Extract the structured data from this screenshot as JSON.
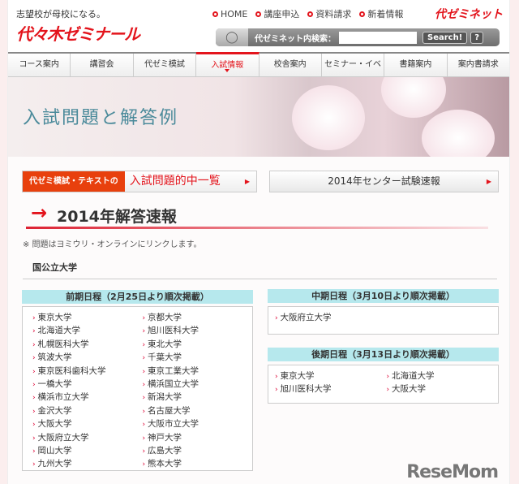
{
  "header": {
    "tagline": "志望校が母校になる。",
    "logo": "代々木ゼミナール",
    "brand": "代ゼミネット",
    "links": [
      "HOME",
      "講座申込",
      "資料請求",
      "新着情報"
    ],
    "search": {
      "label": "代ゼミネット内検索：",
      "value": "",
      "button": "Search!",
      "help": "?"
    }
  },
  "nav": [
    "コース案内",
    "講習会",
    "代ゼミ模試",
    "入試情報",
    "校舎案内",
    "セミナー・イベント",
    "書籍案内",
    "案内書請求"
  ],
  "nav_active": "入試情報",
  "banner": {
    "title": "入試問題と解答例"
  },
  "buttons": {
    "hit_tag": "代ゼミ模試・テキストの",
    "hit_main": "入試問題的中一覧",
    "center": "2014年センター試験速報"
  },
  "section": {
    "title": "2014年解答速報",
    "note": "※ 問題はヨミウリ・オンラインにリンクします。",
    "subtitle": "国公立大学"
  },
  "zenki": {
    "title": "前期日程（2月25日より順次掲載）",
    "items": [
      "東京大学",
      "京都大学",
      "北海道大学",
      "旭川医科大学",
      "札幌医科大学",
      "東北大学",
      "筑波大学",
      "千葉大学",
      "東京医科歯科大学",
      "東京工業大学",
      "一橋大学",
      "横浜国立大学",
      "横浜市立大学",
      "新潟大学",
      "金沢大学",
      "名古屋大学",
      "大阪大学",
      "大阪市立大学",
      "大阪府立大学",
      "神戸大学",
      "岡山大学",
      "広島大学",
      "九州大学",
      "熊本大学"
    ]
  },
  "chuki": {
    "title": "中期日程（3月10日より順次掲載）",
    "items": [
      "大阪府立大学"
    ]
  },
  "koki": {
    "title": "後期日程（3月13日より順次掲載）",
    "items": [
      "東京大学",
      "北海道大学",
      "旭川医科大学",
      "大阪大学"
    ]
  },
  "watermark": "ReseMom"
}
